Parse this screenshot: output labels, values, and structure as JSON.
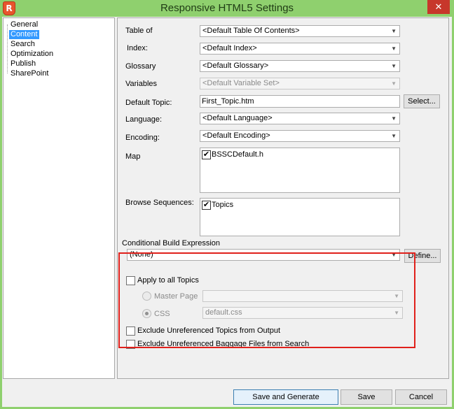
{
  "window": {
    "title": "Responsive HTML5 Settings",
    "app_icon_glyph": "R",
    "close_glyph": "✕",
    "frame_color": "#8fd06e",
    "close_color": "#c7372b"
  },
  "nav": {
    "items": [
      {
        "label": "General",
        "selected": false
      },
      {
        "label": "Content",
        "selected": true
      },
      {
        "label": "Search",
        "selected": false
      },
      {
        "label": "Optimization",
        "selected": false
      },
      {
        "label": "Publish",
        "selected": false
      },
      {
        "label": "SharePoint",
        "selected": false
      }
    ]
  },
  "content": {
    "table_of_label": "Table of",
    "table_of_value": "<Default Table Of Contents>",
    "index_label": "Index:",
    "index_value": "<Default Index>",
    "glossary_label": "Glossary",
    "glossary_value": "<Default Glossary>",
    "variables_label": "Variables",
    "variables_value": "<Default Variable Set>",
    "default_topic_label": "Default Topic:",
    "default_topic_value": "First_Topic.htm",
    "select_button": "Select...",
    "language_label": "Language:",
    "language_value": "<Default Language>",
    "encoding_label": "Encoding:",
    "encoding_value": "<Default Encoding>",
    "map_label": "Map",
    "map_items": [
      {
        "label": "BSSCDefault.h",
        "checked": true
      }
    ],
    "browse_label": "Browse Sequences:",
    "browse_items": [
      {
        "label": "Topics",
        "checked": true
      }
    ],
    "cbe_label": "Conditional Build Expression",
    "cbe_value": "(None)",
    "define_button": "Define...",
    "apply_all_label": "Apply to all Topics",
    "master_page_label": "Master Page",
    "master_page_value": "",
    "css_label": "CSS",
    "css_value": "default.css",
    "exclude_topics_label": "Exclude Unreferenced Topics from Output",
    "exclude_baggage_label": "Exclude Unreferenced Baggage Files from Search",
    "highlight_color": "#e0201b"
  },
  "footer": {
    "save_generate": "Save and Generate",
    "save": "Save",
    "cancel": "Cancel"
  },
  "glyphs": {
    "check": "✔",
    "combo_arrow": "▼"
  }
}
